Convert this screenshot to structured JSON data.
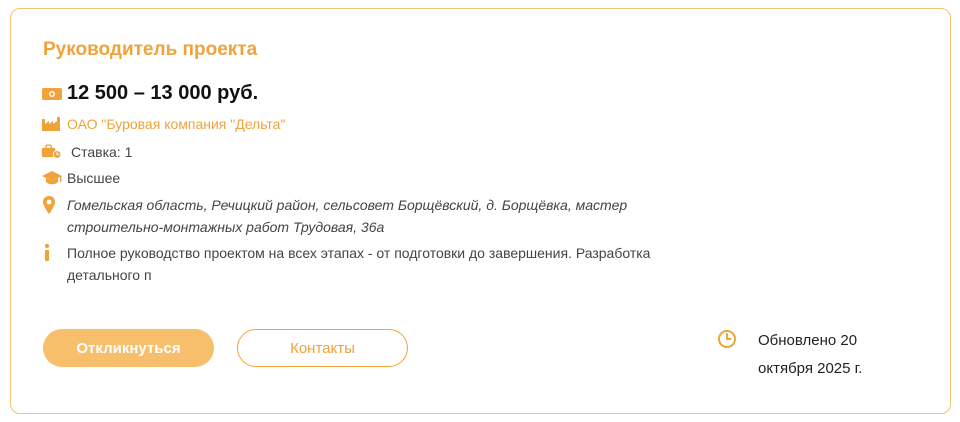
{
  "vacancy": {
    "title": "Руководитель проекта",
    "salary": "12 500 – 13 000 руб.",
    "company": "ОАО \"Буровая компания \"Дельта\"",
    "rate": "Ставка: 1",
    "education": "Высшее",
    "address": "Гомельская область, Речицкий район, сельсовет Борщёвский, д. Борщёвка, мастер строительно-монтажных работ Трудовая, 36а",
    "description": "Полное руководство проектом на всех этапах - от подготовки до завершения. Разработка детального п",
    "updated": "Обновлено 20 октября 2025 г."
  },
  "actions": {
    "respond_label": "Откликнуться",
    "contacts_label": "Контакты"
  },
  "icons": {
    "salary": "money-icon",
    "company": "factory-icon",
    "rate": "briefcase-clock-icon",
    "education": "graduation-cap-icon",
    "address": "location-pin-icon",
    "description": "info-icon",
    "updated": "clock-icon"
  },
  "colors": {
    "accent": "#f0a33a",
    "button_fill": "#f7bf6c",
    "border": "#f1c56e"
  }
}
